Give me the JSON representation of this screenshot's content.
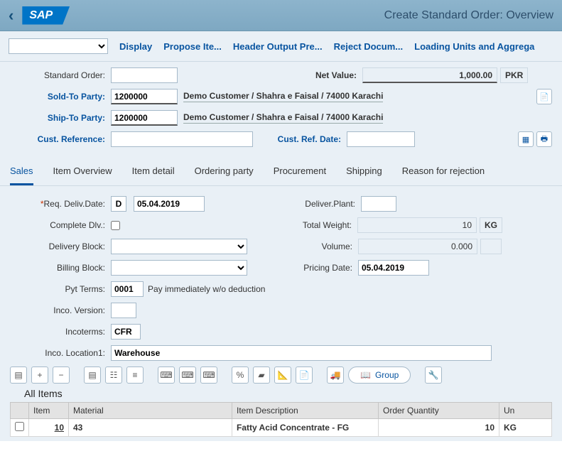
{
  "header": {
    "title": "Create Standard Order: Overview"
  },
  "toolbar": {
    "display": "Display",
    "propose": "Propose Ite...",
    "headerout": "Header Output Pre...",
    "reject": "Reject Docum...",
    "loading": "Loading Units and Aggrega"
  },
  "form": {
    "std_label": "Standard Order:",
    "std_val": "",
    "net_label": "Net Value:",
    "net_val": "1,000.00",
    "net_cur": "PKR",
    "sold_label": "Sold-To Party:",
    "sold_val": "1200000",
    "sold_txt": "Demo Customer / Shahra e Faisal / 74000 Karachi",
    "ship_label": "Ship-To Party:",
    "ship_val": "1200000",
    "ship_txt": "Demo Customer / Shahra e Faisal / 74000 Karachi",
    "cref_label": "Cust. Reference:",
    "cref_val": "",
    "crdate_label": "Cust. Ref. Date:",
    "crdate_val": ""
  },
  "tabs": {
    "sales": "Sales",
    "itemov": "Item Overview",
    "itemd": "Item detail",
    "ordp": "Ordering party",
    "proc": "Procurement",
    "ship": "Shipping",
    "reason": "Reason for rejection"
  },
  "sales": {
    "reqd_label": "Req. Deliv.Date:",
    "reqd_type": "D",
    "reqd_val": "05.04.2019",
    "dplant_label": "Deliver.Plant:",
    "dplant_val": "",
    "compl_label": "Complete Dlv.:",
    "tw_label": "Total Weight:",
    "tw_val": "10",
    "tw_unit": "KG",
    "dblock_label": "Delivery Block:",
    "vol_label": "Volume:",
    "vol_val": "0.000",
    "vol_unit": "",
    "bblock_label": "Billing Block:",
    "pdate_label": "Pricing Date:",
    "pdate_val": "05.04.2019",
    "pyt_label": "Pyt Terms:",
    "pyt_val": "0001",
    "pyt_txt": "Pay immediately w/o deduction",
    "incv_label": "Inco. Version:",
    "incv_val": "",
    "inct_label": "Incoterms:",
    "inct_val": "CFR",
    "incl_label": "Inco. Location1:",
    "incl_val": "Warehouse"
  },
  "tb2": {
    "group": "Group"
  },
  "items": {
    "title": "All Items",
    "h_item": "Item",
    "h_mat": "Material",
    "h_desc": "Item Description",
    "h_qty": "Order Quantity",
    "h_un": "Un",
    "r1": {
      "item": "10",
      "mat": "43",
      "desc": "Fatty Acid Concentrate - FG",
      "qty": "10",
      "un": "KG"
    }
  }
}
